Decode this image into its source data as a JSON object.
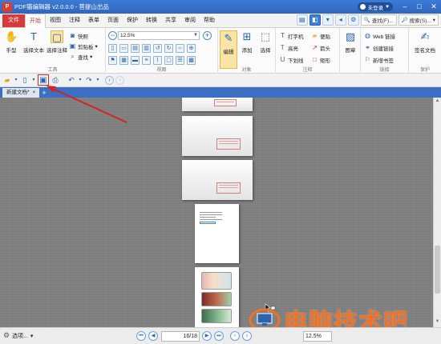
{
  "app": {
    "title": "PDF猫编辑器 v2.0.0.0 - 菩提山出品",
    "logo_text": "P",
    "login_label": "未登录",
    "window_controls": [
      "minimize",
      "maximize",
      "close"
    ]
  },
  "menu": {
    "items": [
      "文件",
      "开始",
      "视图",
      "注释",
      "表单",
      "页面",
      "保护",
      "转换",
      "共享",
      "审阅",
      "帮助"
    ],
    "active": "开始",
    "find_label": "查找(F)...",
    "search_label": "搜索(S)..."
  },
  "ribbon": {
    "tools_group": {
      "label": "工具",
      "hand": "手型",
      "select_text": "选择文本",
      "select_annot": "选择注释",
      "snapshot": "快照",
      "clipboard": "剪贴板",
      "find": "查找"
    },
    "view_group": {
      "label": "视图",
      "zoom_value": "12.5%"
    },
    "object_group": {
      "label": "对象",
      "edit": "编辑",
      "add": "添加",
      "select": "选择"
    },
    "comment_group": {
      "label": "注释",
      "typewriter": "打字机",
      "note": "便贴",
      "highlight": "高亮",
      "arrow": "箭头",
      "underline": "下划线",
      "rectangle": "矩形"
    },
    "image_group": {
      "image": "图章"
    },
    "link_group": {
      "label": "链接",
      "web_link": "Web 链接",
      "create_link": "创建链接",
      "new_bookmark": "新增书签"
    },
    "protect_group": {
      "label": "保护",
      "sign_doc": "签名文档"
    }
  },
  "tabs": {
    "doc_name": "新建文档",
    "modified_mark": "*",
    "close": "×",
    "add": "+"
  },
  "status": {
    "options_label": "选项...",
    "current_page": "16",
    "total_pages": "18",
    "zoom": "12.5%"
  },
  "watermark": {
    "text": "电脑技术吧"
  },
  "colors": {
    "titlebar": "#2e66bd",
    "accent_red": "#d62424",
    "canvas": "#7d7d7d",
    "watermark_orange": "#f37120"
  }
}
